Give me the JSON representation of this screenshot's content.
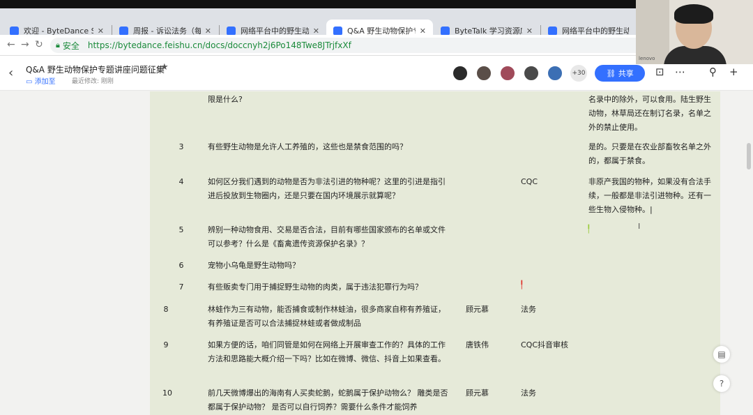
{
  "browser": {
    "tabs": [
      {
        "label": "欢迎 - ByteDance SSO",
        "icon_color": "#3370ff",
        "active": false
      },
      {
        "label": "周报 - 诉讼法务（每周三…",
        "icon_color": "#3370ff",
        "active": false
      },
      {
        "label": "网络平台中的野生动物…",
        "icon_color": "#3370ff",
        "active": false
      },
      {
        "label": "Q&A 野生动物保护专题…",
        "icon_color": "#3370ff",
        "active": true
      },
      {
        "label": "ByteTalk 学习资源库网",
        "icon_color": "#3370ff",
        "active": false
      },
      {
        "label": "网络平台中的野生动物…",
        "icon_color": "#3370ff",
        "active": false
      }
    ],
    "secure_label": "安全",
    "url": "https://bytedance.feishu.cn/docs/doccnyh2j6Po148Twe8JTrjfxXf"
  },
  "doc": {
    "title": "Q&A 野生动物保护专题讲座问题征集",
    "folder_label": "添加至",
    "modified_label": "最近修改: 刚刚",
    "collaborator_count": "+30",
    "share_label": "共享"
  },
  "table": {
    "rows": [
      {
        "num": "",
        "question": "限是什么?",
        "owner": "",
        "tag": "",
        "answer": "名录中的除外，可以食用。陆生野生动物，林草局还在制订名录，名单之外的禁止使用。"
      },
      {
        "num": "3",
        "question": "有些野生动物是允许人工养殖的，这些也是禁食范围的吗？",
        "owner": "",
        "tag": "",
        "answer": "是的。只要是在农业部畜牧名单之外的，都属于禁食。"
      },
      {
        "num": "4",
        "question": "如何区分我们遇到的动物是否为非法引进的物种呢？这里的引进是指引进后投放到生物圈内，还是只要在国内环境展示就算呢？",
        "owner": "",
        "tag": "CQC",
        "answer": "非原产我国的物种，如果没有合法手续，一般都是非法引进物种。还有一些生物入侵物种。|"
      },
      {
        "num": "5",
        "question": "辨别一种动物食用、交易是否合法，目前有哪些国家颁布的名单或文件可以参考？什么是《畜禽遗传资源保护名录》？",
        "owner": "",
        "tag": "",
        "answer": ""
      },
      {
        "num": "6",
        "question": "宠物小乌龟是野生动物吗？",
        "owner": "",
        "tag": "",
        "answer": ""
      },
      {
        "num": "7",
        "question": "有些贩卖专门用于捕捉野生动物的肉类，属于违法犯罪行为吗？",
        "owner": "",
        "tag": "",
        "answer": ""
      },
      {
        "num": "8",
        "question": "林蛙作为三有动物，能否捕食或制作林蛙油，很多商家自称有养殖证，有养殖证是否可以合法捕捉林蛙或者做成制品",
        "owner": "顾元慕",
        "tag": "法务",
        "answer": ""
      },
      {
        "num": "9",
        "question": "如果方便的话，咱们同管是如何在网络上开展审查工作的？具体的工作方法和思路能大概介绍一下吗？比如在微博、微信、抖音上如果查看。",
        "owner": "唐铁伟",
        "tag": "CQC抖音审核",
        "answer": ""
      },
      {
        "num": "10",
        "question": "前几天微博爆出的海南有人买卖蛇鹅，蛇鹅属于保护动物么？ 雕类是否都属于保护动物？ 是否可以自行饲养？需要什么条件才能饲养",
        "owner": "顾元慕",
        "tag": "法务",
        "answer": ""
      }
    ]
  },
  "webcam": {
    "monitor_label": "lenovo"
  }
}
